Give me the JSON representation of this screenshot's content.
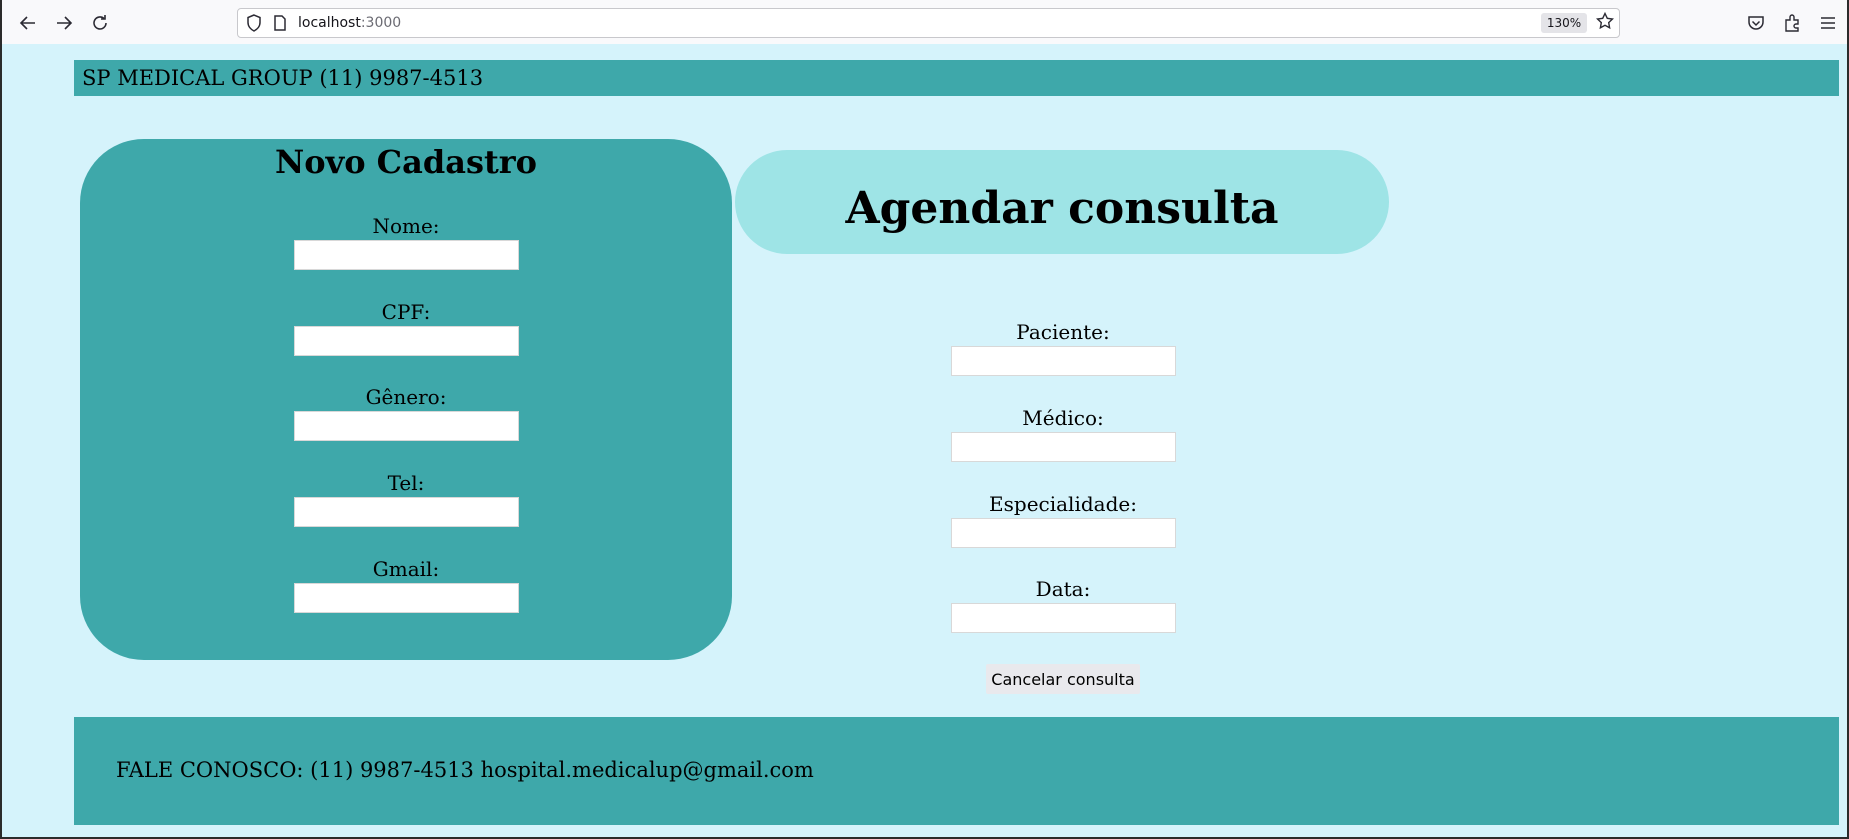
{
  "browser": {
    "url_host": "localhost",
    "url_port": ":3000",
    "zoom": "130%",
    "icons": [
      "back-icon",
      "forward-icon",
      "reload-icon",
      "shield-icon",
      "page-icon",
      "bookmark-star-icon",
      "pocket-icon",
      "extensions-icon",
      "menu-icon"
    ]
  },
  "header": {
    "text": "SP MEDICAL GROUP (11) 9987-4513"
  },
  "cadastro": {
    "title": "Novo Cadastro",
    "fields": [
      {
        "label": "Nome:",
        "value": ""
      },
      {
        "label": "CPF:",
        "value": ""
      },
      {
        "label": "Gênero:",
        "value": ""
      },
      {
        "label": "Tel:",
        "value": ""
      },
      {
        "label": "Gmail:",
        "value": ""
      }
    ]
  },
  "agenda": {
    "title": "Agendar consulta",
    "fields": [
      {
        "label": "Paciente:",
        "value": ""
      },
      {
        "label": "Médico:",
        "value": ""
      },
      {
        "label": "Especialidade:",
        "value": ""
      },
      {
        "label": "Data:",
        "value": ""
      }
    ],
    "cancel_label": "Cancelar consulta"
  },
  "footer": {
    "text": "FALE CONOSCO: (11) 9987-4513 hospital.medicalup@gmail.com"
  },
  "colors": {
    "page_bg": "#d5f3fb",
    "teal": "#3ea8aa",
    "light_teal": "#9ee4e6"
  }
}
